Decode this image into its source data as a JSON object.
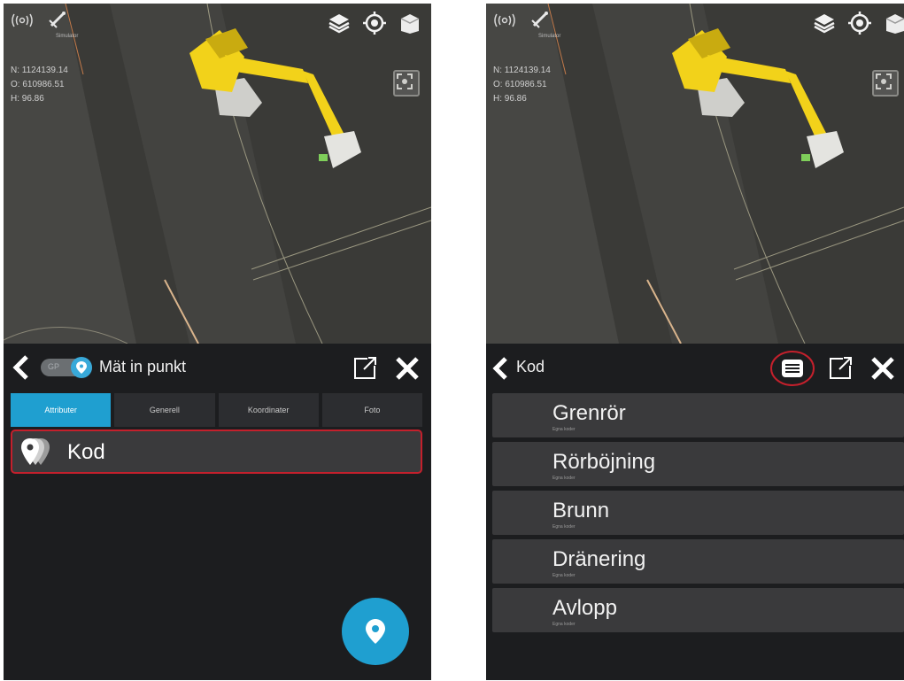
{
  "left_screen": {
    "sim_label": "Simulator",
    "coords": {
      "n": "N: 1124139.14",
      "o": "O: 610986.51",
      "h": "H: 96.86"
    },
    "header_title": "Mät in punkt",
    "toggle_label": "GP",
    "tabs": [
      {
        "label": "Attributer",
        "active": true
      },
      {
        "label": "Generell",
        "active": false
      },
      {
        "label": "Koordinater",
        "active": false
      },
      {
        "label": "Foto",
        "active": false
      }
    ],
    "kod_label": "Kod",
    "icons": {
      "signal": "radio-signal-icon",
      "satellite": "satellite-icon",
      "layers": "layers-icon",
      "locate": "locate-target-icon",
      "view3d": "cube-icon",
      "fit": "fit-view-icon",
      "back": "chevron-left-icon",
      "popout": "external-window-icon",
      "close": "close-icon",
      "fab": "map-pin-icon"
    }
  },
  "right_screen": {
    "sim_label": "Simulator",
    "coords": {
      "n": "N: 1124139.14",
      "o": "O: 610986.51",
      "h": "H: 96.86"
    },
    "header_title": "Kod",
    "codes": [
      {
        "name": "Grenrör",
        "sub": "Egna koder"
      },
      {
        "name": "Rörböjning",
        "sub": "Egna koder"
      },
      {
        "name": "Brunn",
        "sub": "Egna koder"
      },
      {
        "name": "Dränering",
        "sub": "Egna koder"
      },
      {
        "name": "Avlopp",
        "sub": "Egna koder"
      }
    ],
    "icons": {
      "list": "code-list-icon",
      "popout": "external-window-icon",
      "close": "close-icon"
    }
  },
  "colors": {
    "accent": "#1f9fd0",
    "highlight": "#c4202c",
    "panel": "#1c1d1f",
    "row": "#3a3a3c",
    "excavator": "#f2d21a"
  }
}
